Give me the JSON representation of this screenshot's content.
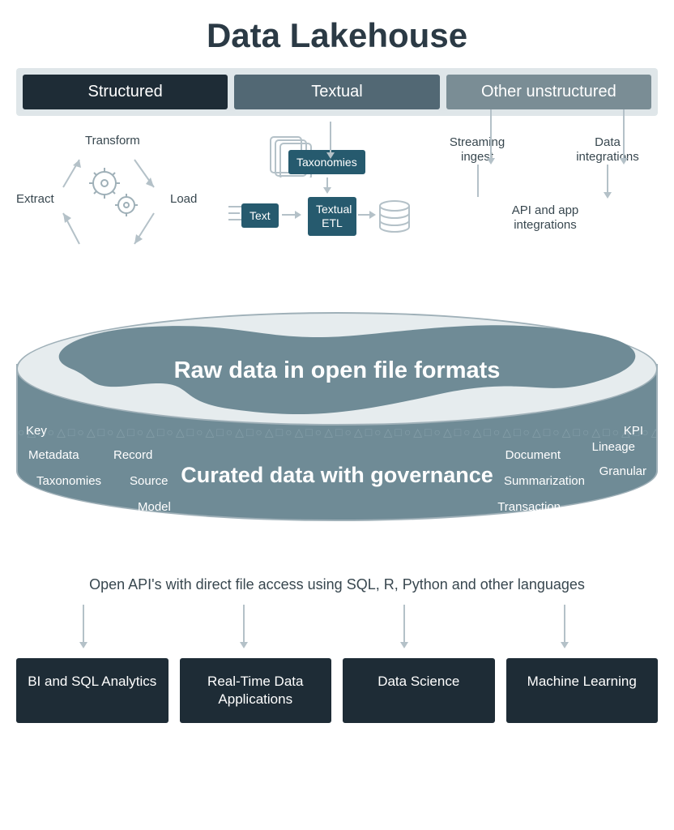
{
  "title": "Data Lakehouse",
  "tabs": {
    "structured": "Structured",
    "textual": "Textual",
    "other": "Other unstructured"
  },
  "etl": {
    "transform": "Transform",
    "load": "Load",
    "extract": "Extract"
  },
  "textual_boxes": {
    "taxonomies": "Taxonomies",
    "text": "Text",
    "textual_etl": "Textual ETL"
  },
  "flows": {
    "streaming": "Streaming ingest",
    "data_integrations": "Data integrations",
    "api_app": "API and app integrations"
  },
  "lake": {
    "raw_title": "Raw data in open file formats",
    "curated_title": "Curated data with governance",
    "terms": {
      "key": "Key",
      "metadata": "Metadata",
      "taxonomies": "Taxonomies",
      "record": "Record",
      "source": "Source",
      "model": "Model",
      "document": "Document",
      "summarization": "Summarization",
      "transaction": "Transaction",
      "kpi": "KPI",
      "lineage": "Lineage",
      "granular": "Granular"
    }
  },
  "api_text": "Open API's with direct file access using SQL, R, Python and other languages",
  "bottom_boxes": {
    "bi": "BI and SQL Analytics",
    "realtime": "Real-Time Data Applications",
    "datasci": "Data Science",
    "ml": "Machine Learning"
  }
}
